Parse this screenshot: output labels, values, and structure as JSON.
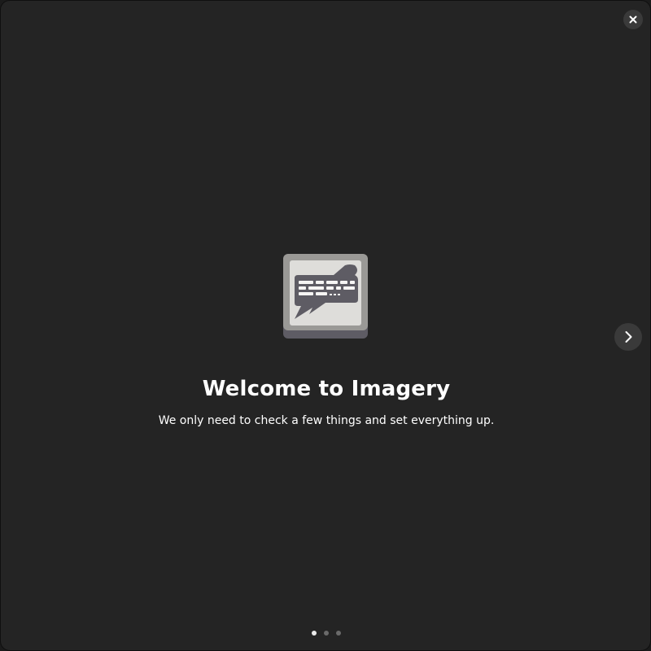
{
  "welcome": {
    "title": "Welcome to Imagery",
    "subtitle": "We only need to check a few things and set everything up."
  },
  "controls": {
    "close_icon": "close-icon",
    "next_icon": "chevron-right-icon"
  },
  "pager": {
    "pages": 3,
    "active_index": 0
  },
  "colors": {
    "background": "#242424",
    "button_bg": "#3a3a3a",
    "text": "#ffffff",
    "dot_active": "#eaeaea",
    "dot_inactive": "#6a6a6a"
  }
}
